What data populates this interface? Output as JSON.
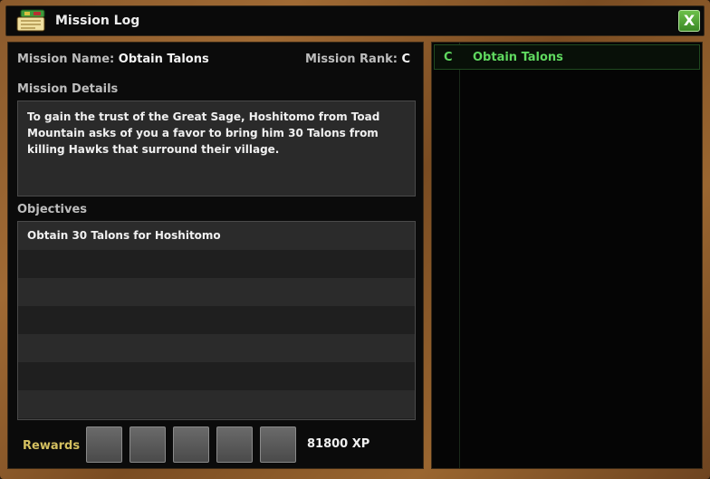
{
  "window": {
    "title": "Mission Log",
    "close_label": "X"
  },
  "mission": {
    "name_label": "Mission Name:",
    "name": "Obtain Talons",
    "rank_label": "Mission Rank:",
    "rank": "C",
    "details_label": "Mission Details",
    "details": "To gain the trust of the Great Sage, Hoshitomo from Toad Mountain asks of you a favor to bring him 30 Talons from killing Hawks that surround their village.",
    "objectives_label": "Objectives",
    "objectives": [
      "Obtain 30 Talons for Hoshitomo",
      "",
      "",
      "",
      "",
      "",
      "",
      ""
    ],
    "rewards_label": "Rewards",
    "reward_slots": 5,
    "xp": "81800 XP"
  },
  "mission_list": [
    {
      "rank": "C",
      "name": "Obtain Talons"
    }
  ],
  "colors": {
    "accent_green": "#5fd85f",
    "rewards_gold": "#d4c060",
    "frame_wood": "#8a5a2c"
  },
  "icons": {
    "title": "scroll-book-icon",
    "close": "close-icon"
  }
}
